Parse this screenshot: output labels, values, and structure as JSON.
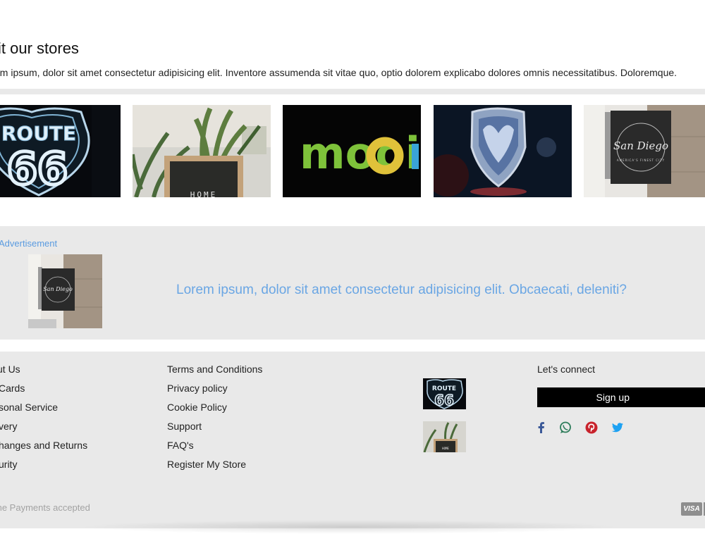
{
  "stores_section": {
    "title": "sit our stores",
    "intro": "em ipsum, dolor sit amet consectetur adipisicing elit. Inventore assumenda sit vitae quo, optio dolorem explicabo dolores omnis necessitatibus. Doloremque.",
    "cards": [
      {
        "image": "route-66-neon-sign",
        "sign_text": "ROUTE",
        "sign_number": "66"
      },
      {
        "image": "plants-home-letterboard",
        "sign_text": "HOME"
      },
      {
        "image": "mooi-neon-sign",
        "sign_text": "mooi"
      },
      {
        "image": "ram-emblem-neon"
      },
      {
        "image": "san-diego-shop-sign",
        "sign_text": "San Diego",
        "sign_subtext": "AMERICA'S FINEST CITY"
      }
    ]
  },
  "advertisement": {
    "label": "Advertisement",
    "image": "san-diego-shop-sign",
    "sign_text": "San Diego",
    "text": "Lorem ipsum, dolor sit amet consectetur adipisicing elit. Obcaecati, deleniti?"
  },
  "footer": {
    "col1": [
      "ut Us",
      "Cards",
      "sonal Service",
      "very",
      "hanges and Returns",
      "urity"
    ],
    "col2": [
      "Terms and Conditions",
      "Privacy policy",
      "Cookie Policy",
      "Support",
      "FAQ's",
      "Register My Store"
    ],
    "thumbs": [
      {
        "image": "route-66-neon-sign",
        "sign_text": "ROUTE",
        "sign_number": "66"
      },
      {
        "image": "plants-home-letterboard",
        "sign_text": "HOME"
      }
    ],
    "connect": {
      "label": "Let's connect",
      "signup_label": "Sign up",
      "social_icons": [
        "facebook-icon",
        "whatsapp-icon",
        "pinterest-icon",
        "twitter-icon"
      ]
    },
    "payments_text": "me Payments accepted",
    "payment_badges": [
      "VISA"
    ]
  },
  "colors": {
    "band_background": "#e9e9e9",
    "ad_blue": "#6aa6e4",
    "signup_background": "#000000",
    "facebook": "#3b5998",
    "whatsapp": "#2e7d5b",
    "pinterest": "#c8232c",
    "twitter": "#1da1f2"
  }
}
